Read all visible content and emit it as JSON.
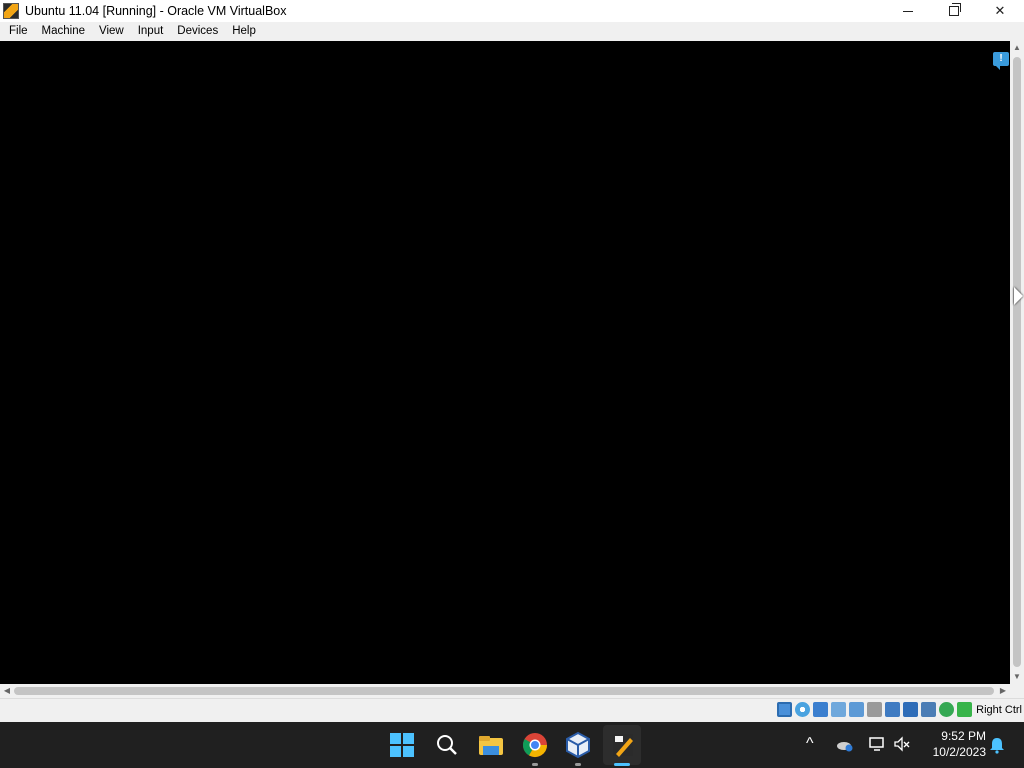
{
  "window": {
    "title": "Ubuntu 11.04 [Running] - Oracle VM VirtualBox",
    "controls": {
      "minimize": "minimize-icon",
      "maximize": "maximize-icon",
      "close": "close-icon"
    }
  },
  "menubar": {
    "items": [
      {
        "label": "File"
      },
      {
        "label": "Machine"
      },
      {
        "label": "View"
      },
      {
        "label": "Input"
      },
      {
        "label": "Devices"
      },
      {
        "label": "Help"
      }
    ]
  },
  "guest_screen": {
    "background": "#000000",
    "notification_icon": "info-bubble-icon"
  },
  "statusbar": {
    "icons": [
      "hard-disk-icon",
      "optical-drive-icon",
      "audio-icon",
      "network-icon",
      "usb-icon",
      "shared-folders-icon",
      "display-icon",
      "video-capture-icon",
      "virtualization-icon",
      "mouse-integration-icon",
      "keyboard-icon"
    ],
    "host_key": "Right Ctrl"
  },
  "taskbar": {
    "apps": [
      "start-icon",
      "search-icon",
      "file-explorer-icon",
      "chrome-icon",
      "virtualbox-manager-icon",
      "virtualbox-vm-icon"
    ],
    "tray": {
      "chevron": "^",
      "time": "9:52 PM",
      "date": "10/2/2023"
    }
  },
  "colors": {
    "accent": "#4cc2ff",
    "taskbar": "#202020",
    "chrome_bg": "#f0f0f0"
  }
}
